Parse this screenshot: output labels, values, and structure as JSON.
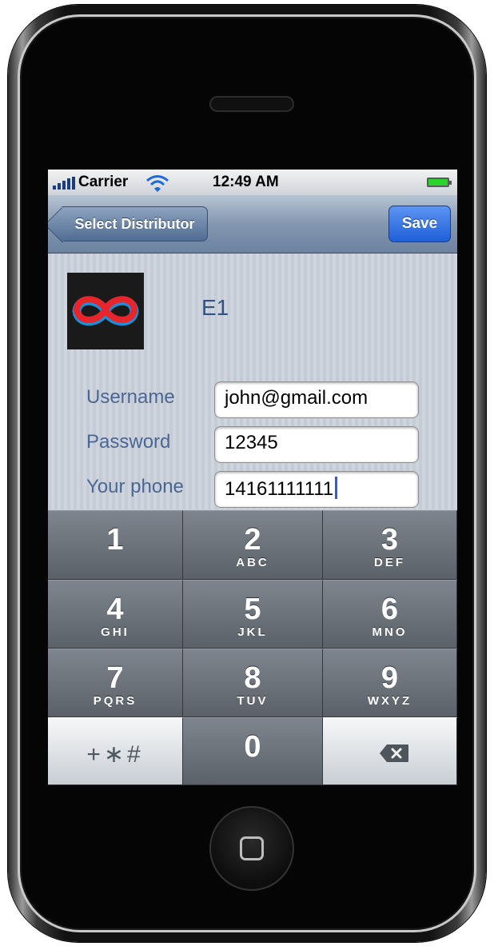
{
  "status_bar": {
    "carrier": "Carrier",
    "time": "12:49 AM",
    "signal_icon": "signal-bars-icon",
    "wifi_icon": "wifi-icon",
    "battery_icon": "battery-icon",
    "battery_color": "#2bd42b"
  },
  "nav": {
    "back_label": "Select Distributor",
    "save_label": "Save",
    "save_color": "#1f5fd8"
  },
  "distributor": {
    "name": "E1",
    "logo_icon": "infinity-logo-icon",
    "logo_colors": [
      "#e8252a",
      "#1b8fd8"
    ]
  },
  "form": {
    "username": {
      "label": "Username",
      "value": "john@gmail.com"
    },
    "password": {
      "label": "Password",
      "value": "12345"
    },
    "phone": {
      "label": "Your phone",
      "value": "14161111111"
    }
  },
  "keypad": {
    "keys": [
      {
        "num": "1",
        "letters": ""
      },
      {
        "num": "2",
        "letters": "ABC"
      },
      {
        "num": "3",
        "letters": "DEF"
      },
      {
        "num": "4",
        "letters": "GHI"
      },
      {
        "num": "5",
        "letters": "JKL"
      },
      {
        "num": "6",
        "letters": "MNO"
      },
      {
        "num": "7",
        "letters": "PQRS"
      },
      {
        "num": "8",
        "letters": "TUV"
      },
      {
        "num": "9",
        "letters": "WXYZ"
      },
      {
        "num": "+∗#",
        "letters": ""
      },
      {
        "num": "0",
        "letters": ""
      },
      {
        "num": "",
        "letters": ""
      }
    ],
    "delete_icon": "backspace-icon"
  }
}
